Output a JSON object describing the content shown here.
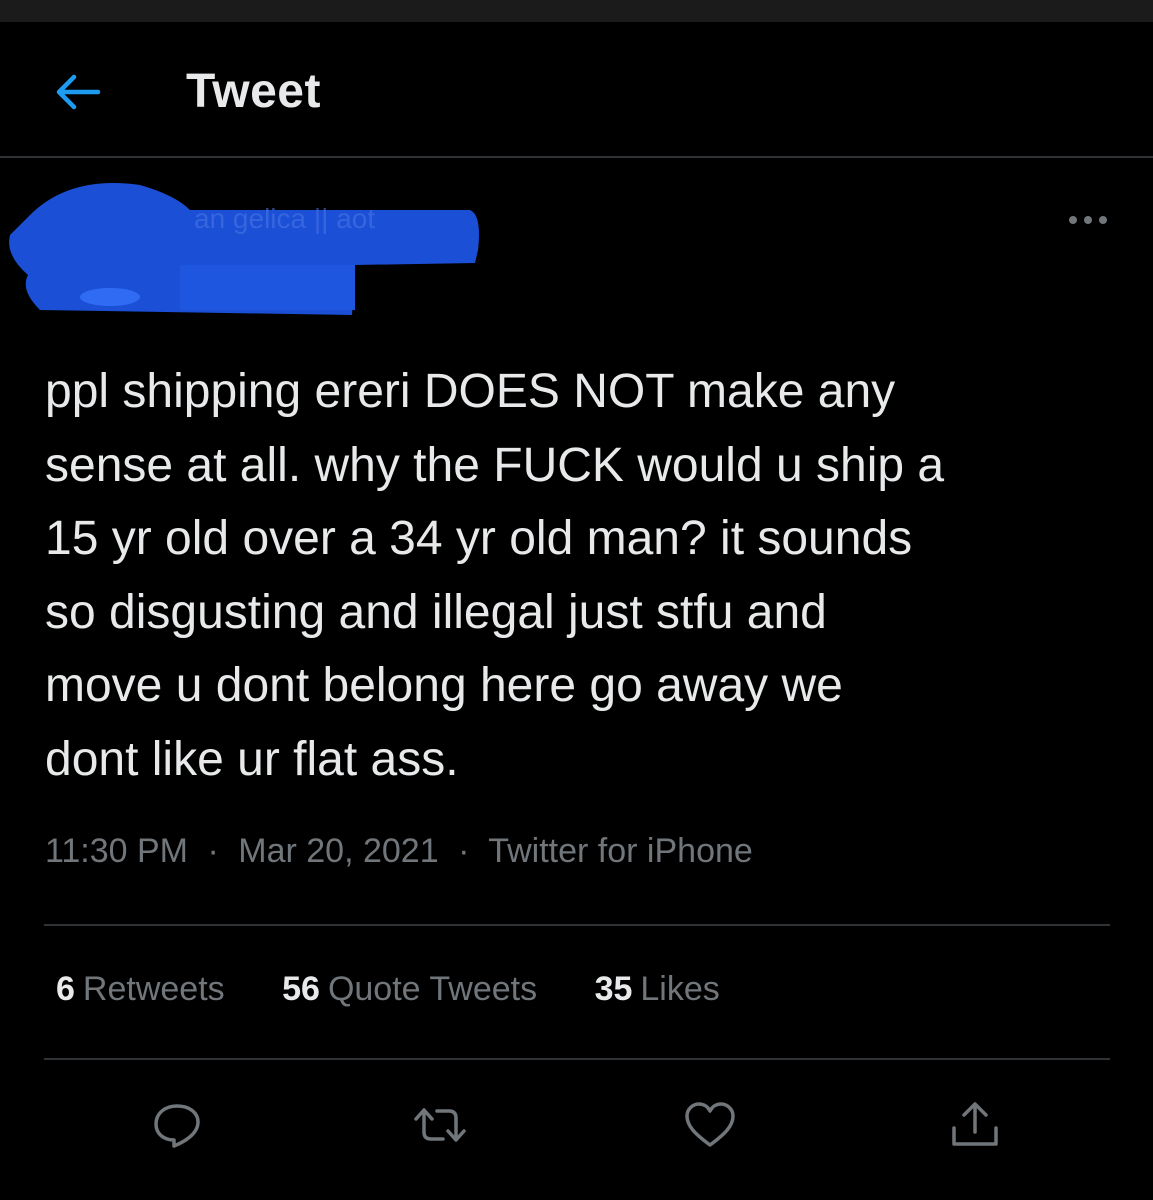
{
  "header": {
    "title": "Tweet",
    "back_icon": "arrow-left-icon"
  },
  "author": {
    "display_name": "an gelica || aot",
    "redacted": true,
    "redaction_color": "#1a4fd6"
  },
  "tweet": {
    "lines": [
      "ppl shipping ereri DOES NOT make any",
      "sense at all. why the FUCK would u ship a",
      "15 yr old over a 34 yr old man? it sounds",
      "so disgusting and illegal just stfu and",
      "move u dont belong here go away we",
      "dont like ur flat ass."
    ]
  },
  "meta": {
    "time": "11:30 PM",
    "separator": "·",
    "date": "Mar 20, 2021",
    "source": "Twitter for iPhone"
  },
  "stats": {
    "retweets_count": "6",
    "retweets_label": "Retweets",
    "quotes_count": "56",
    "quotes_label": "Quote Tweets",
    "likes_count": "35",
    "likes_label": "Likes"
  },
  "actions": {
    "icons": [
      "reply-icon",
      "retweet-icon",
      "like-icon",
      "share-icon"
    ]
  },
  "colors": {
    "background": "#000000",
    "text": "#e7e9ea",
    "muted": "#71767b",
    "accent": "#1d9bf0",
    "divider": "#2f3336"
  }
}
